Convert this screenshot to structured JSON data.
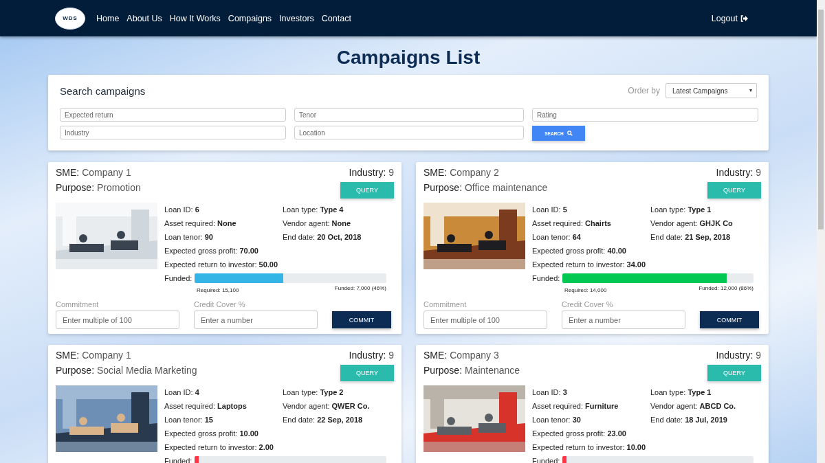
{
  "nav": {
    "logo_text": "WDS",
    "links": [
      {
        "label": "Home"
      },
      {
        "label": "About Us"
      },
      {
        "label": "How It Works"
      },
      {
        "label": "Compaigns"
      },
      {
        "label": "Investors"
      },
      {
        "label": "Contact"
      }
    ],
    "logout": "Logout"
  },
  "title": "Campaigns List",
  "search": {
    "title": "Search campaigns",
    "order_label": "Order by",
    "order_value": "Latest Campaigns",
    "fields": [
      {
        "placeholder": "Expected return"
      },
      {
        "placeholder": "Tenor"
      },
      {
        "placeholder": "Rating"
      },
      {
        "placeholder": "Industry"
      },
      {
        "placeholder": "Location"
      }
    ],
    "button": "SEARCH"
  },
  "campaigns": [
    {
      "sme_label": "SME:",
      "sme": "Company 1",
      "industry_label": "Industry:",
      "industry": "9",
      "purpose_label": "Purpose:",
      "purpose": "Promotion",
      "query": "QUERY",
      "details": [
        {
          "label": "Loan ID:",
          "value": "6"
        },
        {
          "label": "Loan type:",
          "value": "Type 4"
        },
        {
          "label": "Asset required:",
          "value": "None"
        },
        {
          "label": "Vendor agent:",
          "value": "None"
        },
        {
          "label": "Loan tenor:",
          "value": "90"
        },
        {
          "label": "End date:",
          "value": "20 Oct, 2018"
        }
      ],
      "totals": [
        {
          "label": "Expected gross profit:",
          "value": "70.00"
        },
        {
          "label": "Expected return to investor:",
          "value": "50.00"
        }
      ],
      "funded": {
        "label": "Funded:",
        "level": 0.46,
        "color": "#35b5e5",
        "required": "Required: 15,100",
        "amount": "Funded: 7,000 (46%)"
      },
      "commit": {
        "commitment_label": "Commitment",
        "commitment_placeholder": "Enter multiple of 100",
        "cover_label": "Credit Cover %",
        "cover_placeholder": "Enter a number",
        "button": "COMMIT"
      }
    },
    {
      "sme_label": "SME:",
      "sme": "Company 2",
      "industry_label": "Industry:",
      "industry": "9",
      "purpose_label": "Purpose:",
      "purpose": "Office maintenance",
      "query": "QUERY",
      "details": [
        {
          "label": "Loan ID:",
          "value": "5"
        },
        {
          "label": "Loan type:",
          "value": "Type 1"
        },
        {
          "label": "Asset required:",
          "value": "Chairts"
        },
        {
          "label": "Vendor agent:",
          "value": "GHJK Co"
        },
        {
          "label": "Loan tenor:",
          "value": "64"
        },
        {
          "label": "End date:",
          "value": "21 Sep, 2018"
        }
      ],
      "totals": [
        {
          "label": "Expected gross profit:",
          "value": "40.00"
        },
        {
          "label": "Expected return to investor:",
          "value": "34.00"
        }
      ],
      "funded": {
        "label": "Funded:",
        "level": 0.86,
        "color": "#00c853",
        "required": "Required: 14,000",
        "amount": "Funded: 12,000 (86%)"
      },
      "commit": {
        "commitment_label": "Commitment",
        "commitment_placeholder": "Enter multiple of 100",
        "cover_label": "Credit Cover %",
        "cover_placeholder": "Enter a number",
        "button": "COMMIT"
      }
    },
    {
      "sme_label": "SME:",
      "sme": "Company 1",
      "industry_label": "Industry:",
      "industry": "9",
      "purpose_label": "Purpose:",
      "purpose": "Social Media Marketing",
      "query": "QUERY",
      "details": [
        {
          "label": "Loan ID:",
          "value": "4"
        },
        {
          "label": "Loan type:",
          "value": "Type 2"
        },
        {
          "label": "Asset required:",
          "value": "Laptops"
        },
        {
          "label": "Vendor agent:",
          "value": "QWER Co."
        },
        {
          "label": "Loan tenor:",
          "value": "15"
        },
        {
          "label": "End date:",
          "value": "22 Sep, 2018"
        }
      ],
      "totals": [
        {
          "label": "Expected gross profit:",
          "value": "10.00"
        },
        {
          "label": "Expected return to investor:",
          "value": "2.00"
        }
      ],
      "funded": {
        "label": "Funded:",
        "level": 0.02,
        "color": "#ff3547"
      }
    },
    {
      "sme_label": "SME:",
      "sme": "Company 3",
      "industry_label": "Industry:",
      "industry": "9",
      "purpose_label": "Purpose:",
      "purpose": "Maintenance",
      "query": "QUERY",
      "details": [
        {
          "label": "Loan ID:",
          "value": "3"
        },
        {
          "label": "Loan type:",
          "value": "Type 1"
        },
        {
          "label": "Asset required:",
          "value": "Furniture"
        },
        {
          "label": "Vendor agent:",
          "value": "ABCD Co."
        },
        {
          "label": "Loan tenor:",
          "value": "30"
        },
        {
          "label": "End date:",
          "value": "18 Jul, 2019"
        }
      ],
      "totals": [
        {
          "label": "Expected gross profit:",
          "value": "23.00"
        },
        {
          "label": "Expected return to investor:",
          "value": "10.00"
        }
      ],
      "funded": {
        "label": "Funded:",
        "level": 0.02,
        "color": "#ff3547"
      }
    }
  ]
}
